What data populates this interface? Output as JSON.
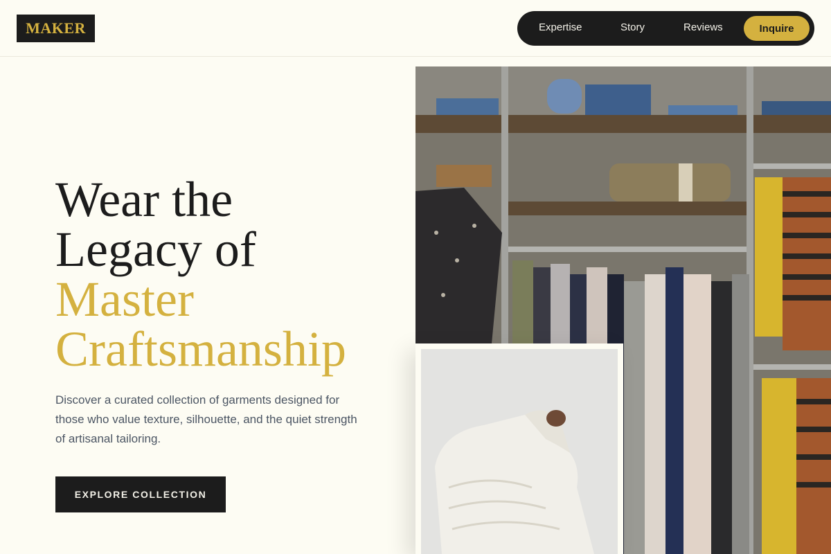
{
  "brand": {
    "logo_text": "MAKER"
  },
  "nav": {
    "items": [
      {
        "label": "Expertise"
      },
      {
        "label": "Story"
      },
      {
        "label": "Reviews"
      }
    ],
    "cta_label": "Inquire"
  },
  "hero": {
    "title_lines": [
      "Wear the",
      "Legacy of"
    ],
    "title_highlight_lines": [
      "Master",
      "Craftsmanship"
    ],
    "description": "Discover a curated collection of garments designed for those who value texture, silhouette, and the quiet strength of artisanal tailoring.",
    "cta_label": "EXPLORE COLLECTION"
  },
  "images": {
    "main": "clothing-rack-photo",
    "inset": "knit-sweater-photo"
  },
  "colors": {
    "background": "#fdfcf3",
    "dark": "#1c1c1c",
    "accent_gold": "#d4b13f",
    "body_text": "#4b5563"
  }
}
